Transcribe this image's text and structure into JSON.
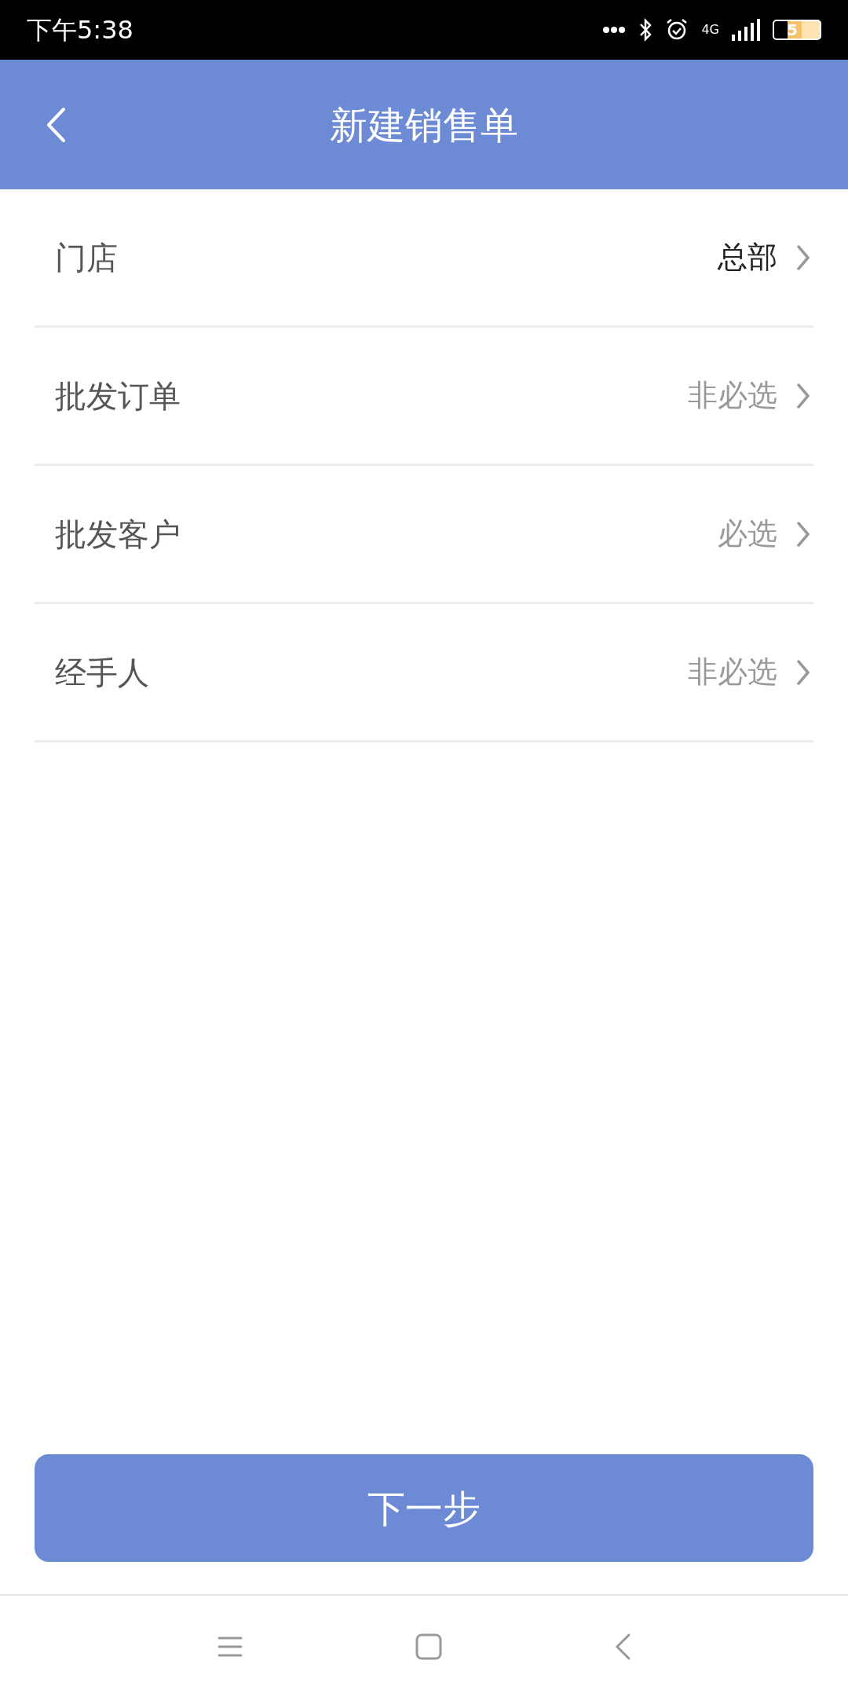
{
  "status_bar": {
    "time": "下午5:38",
    "network": "4G",
    "battery": "5"
  },
  "header": {
    "title": "新建销售单"
  },
  "rows": [
    {
      "label": "门店",
      "value": "总部"
    },
    {
      "label": "批发订单",
      "placeholder": "非必选"
    },
    {
      "label": "批发客户",
      "placeholder": "必选"
    },
    {
      "label": "经手人",
      "placeholder": "非必选"
    }
  ],
  "next_button": {
    "label": "下一步"
  }
}
